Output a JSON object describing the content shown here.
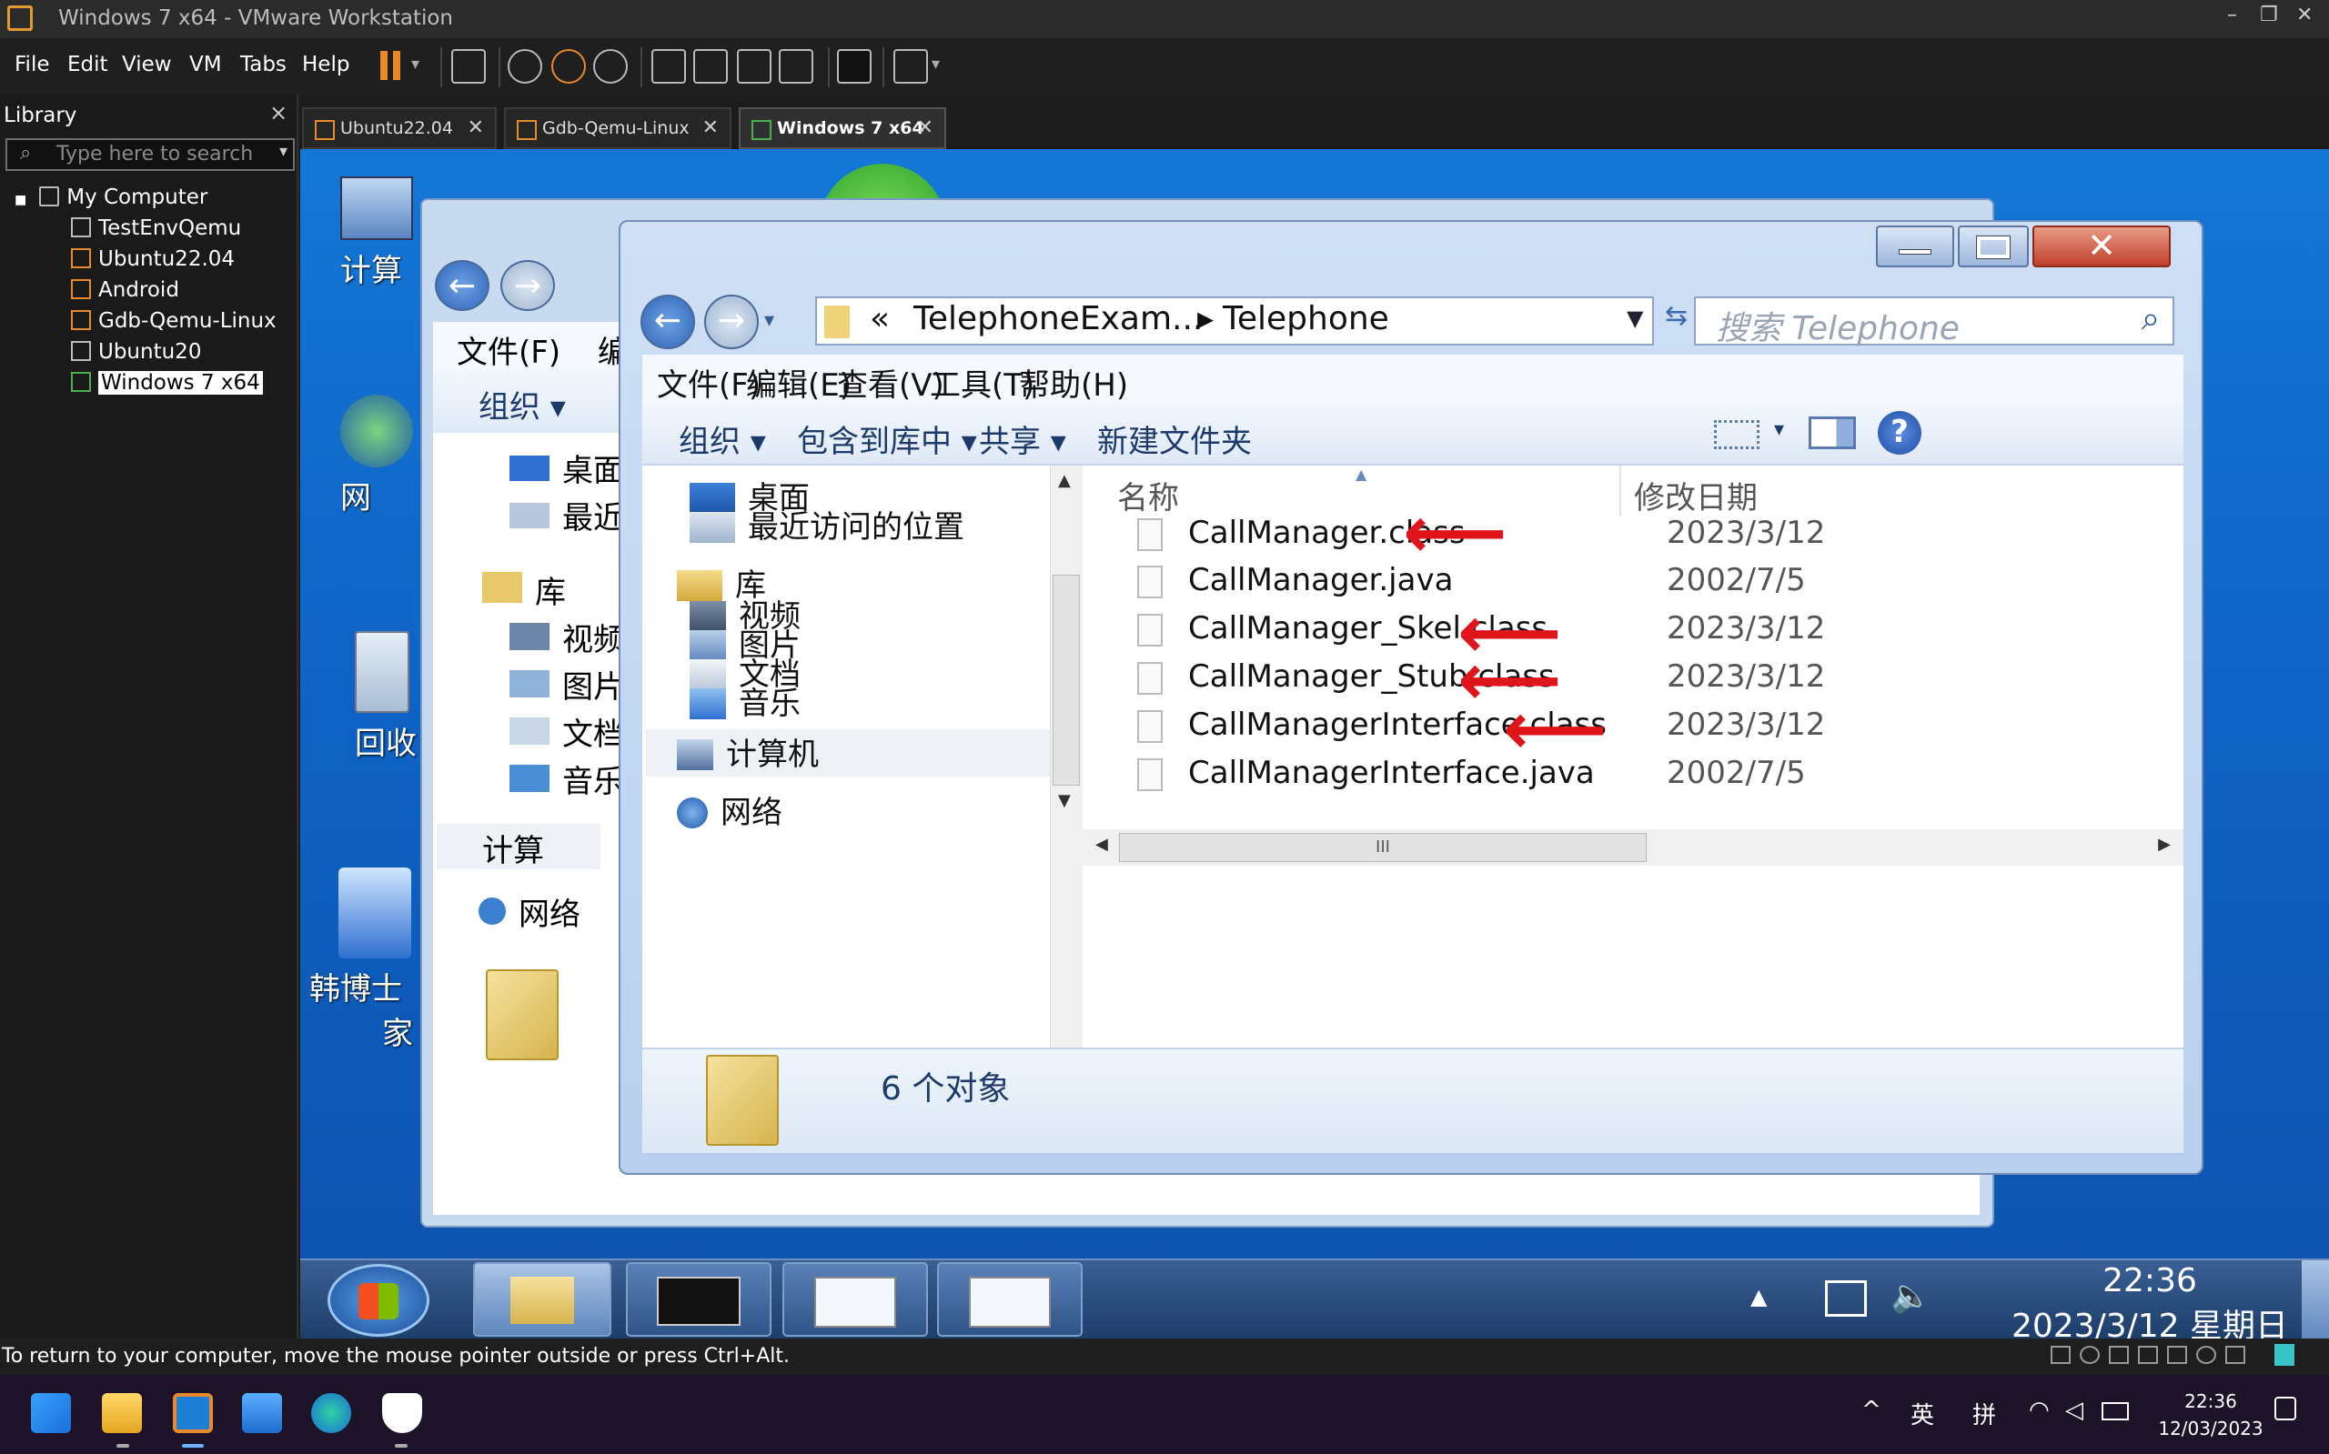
{
  "window": {
    "title": "Windows 7 x64 - VMware Workstation"
  },
  "menubar": {
    "items": [
      "File",
      "Edit",
      "View",
      "VM",
      "Tabs",
      "Help"
    ]
  },
  "library": {
    "title": "Library",
    "close": "×",
    "search_placeholder": "Type here to search",
    "tree": [
      {
        "label": "My Computer"
      },
      {
        "label": "TestEnvQemu"
      },
      {
        "label": "Ubuntu22.04"
      },
      {
        "label": "Android"
      },
      {
        "label": "Gdb-Qemu-Linux"
      },
      {
        "label": "Ubuntu20"
      },
      {
        "label": "Windows 7 x64",
        "selected": true
      }
    ]
  },
  "tabs": [
    {
      "label": "Ubuntu22.04"
    },
    {
      "label": "Gdb-Qemu-Linux"
    },
    {
      "label": "Windows 7 x64",
      "active": true
    }
  ],
  "desktop": {
    "icons": [
      "计算",
      "网",
      "回收",
      "韩博士",
      "家"
    ]
  },
  "bg_explorer": {
    "menu_label": "文件(F)",
    "menu_more": "编",
    "organize": "组织 ▾",
    "nav": [
      "桌面",
      "最近",
      "库",
      "视频",
      "图片",
      "文档",
      "音乐",
      "计算",
      "网络"
    ]
  },
  "explorer": {
    "address": {
      "prefix": "«",
      "crumb1": "TelephoneExam...",
      "separator": "▸",
      "crumb2": "Telephone"
    },
    "search_placeholder": "搜索 Telephone",
    "menu": [
      "文件(F)",
      "编辑(E)",
      "查看(V)",
      "工具(T)",
      "帮助(H)"
    ],
    "toolbar": [
      "组织 ▾",
      "包含到库中 ▾",
      "共享 ▾",
      "新建文件夹"
    ],
    "nav": {
      "desktop": "桌面",
      "recent": "最近访问的位置",
      "libraries": "库",
      "videos": "视频",
      "pictures": "图片",
      "documents": "文档",
      "music": "音乐",
      "computer": "计算机",
      "network": "网络"
    },
    "columns": {
      "name": "名称",
      "modified": "修改日期"
    },
    "files": [
      {
        "name": "CallManager.class",
        "date": "2023/3/12"
      },
      {
        "name": "CallManager.java",
        "date": "2002/7/5"
      },
      {
        "name": "CallManager_Skel.class",
        "date": "2023/3/12"
      },
      {
        "name": "CallManager_Stub.class",
        "date": "2023/3/12"
      },
      {
        "name": "CallManagerInterface.class",
        "date": "2023/3/12"
      },
      {
        "name": "CallManagerInterface.java",
        "date": "2002/7/5"
      }
    ],
    "hscroll_grip": "III",
    "status": "6 个对象"
  },
  "w7taskbar": {
    "time": "22:36",
    "date": "2023/3/12 星期日"
  },
  "vm_status": "To return to your computer, move the mouse pointer outside or press Ctrl+Alt.",
  "host": {
    "ime_lang": "英",
    "ime_mode": "拼",
    "time": "22:36",
    "date": "12/03/2023"
  },
  "colors": {
    "annotation_red": "#e0141b",
    "vm_accent": "#e39b2e"
  }
}
